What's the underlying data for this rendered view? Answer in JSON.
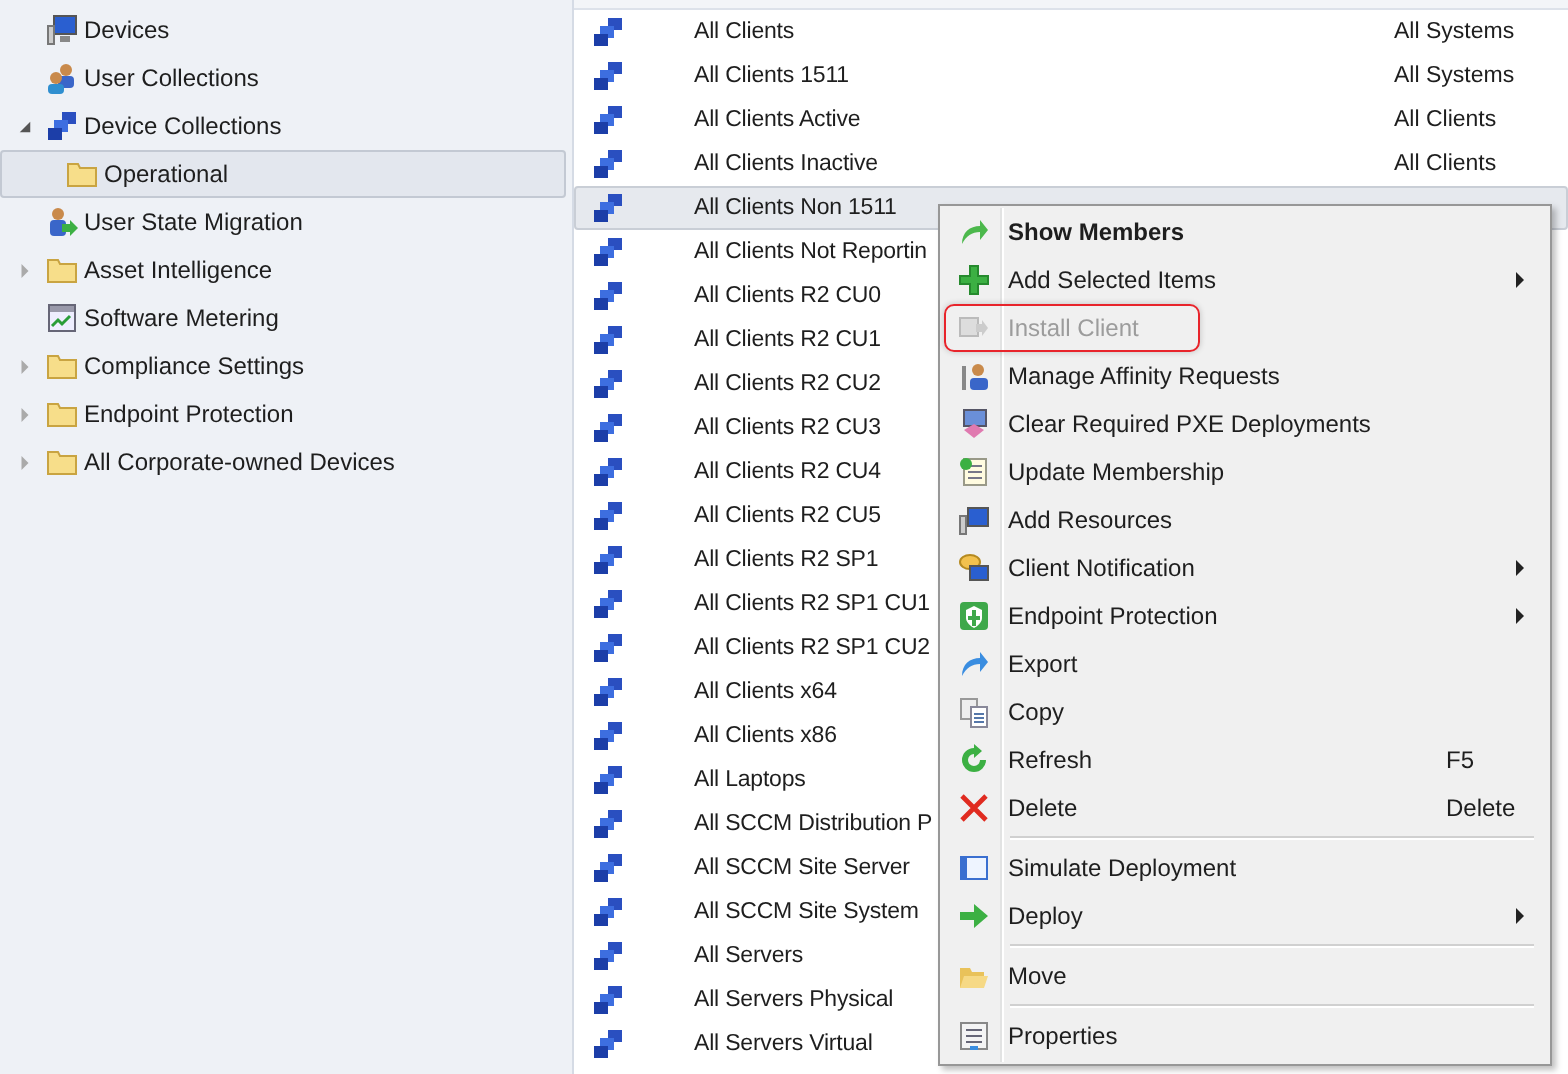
{
  "tree": [
    {
      "label": "Devices",
      "kind": "monitor",
      "selected": false
    },
    {
      "label": "User Collections",
      "kind": "users",
      "selected": false
    },
    {
      "label": "Device Collections",
      "kind": "collection",
      "expanded": true,
      "selected": false,
      "children": [
        {
          "label": "Operational",
          "kind": "folder",
          "selected": true
        }
      ]
    },
    {
      "label": "User State Migration",
      "kind": "migration",
      "selected": false
    },
    {
      "label": "Asset Intelligence",
      "kind": "folder",
      "expanded": false,
      "selected": false
    },
    {
      "label": "Software Metering",
      "kind": "metering",
      "selected": false
    },
    {
      "label": "Compliance Settings",
      "kind": "folder",
      "expanded": false,
      "selected": false
    },
    {
      "label": "Endpoint Protection",
      "kind": "folder",
      "expanded": false,
      "selected": false
    },
    {
      "label": "All Corporate-owned Devices",
      "kind": "folder",
      "expanded": false,
      "selected": false
    }
  ],
  "rows": [
    {
      "name": "All Clients",
      "column_2": "All Systems",
      "selected": false
    },
    {
      "name": "All Clients 1511",
      "column_2": "All Systems",
      "selected": false
    },
    {
      "name": "All Clients Active",
      "column_2": "All Clients",
      "selected": false
    },
    {
      "name": "All Clients Inactive",
      "column_2": "All Clients",
      "selected": false
    },
    {
      "name": "All Clients Non 1511",
      "selected": true
    },
    {
      "name": "All Clients Not Reportin",
      "selected": false
    },
    {
      "name": "All Clients R2 CU0",
      "selected": false
    },
    {
      "name": "All Clients R2 CU1",
      "selected": false
    },
    {
      "name": "All Clients R2 CU2",
      "selected": false
    },
    {
      "name": "All Clients R2 CU3",
      "selected": false
    },
    {
      "name": "All Clients R2 CU4",
      "selected": false
    },
    {
      "name": "All Clients R2 CU5",
      "selected": false
    },
    {
      "name": "All Clients R2 SP1",
      "selected": false
    },
    {
      "name": "All Clients R2 SP1 CU1",
      "selected": false
    },
    {
      "name": "All Clients R2 SP1 CU2",
      "selected": false
    },
    {
      "name": "All Clients x64",
      "selected": false
    },
    {
      "name": "All Clients x86",
      "selected": false
    },
    {
      "name": "All Laptops",
      "selected": false
    },
    {
      "name": "All SCCM Distribution P",
      "selected": false
    },
    {
      "name": "All SCCM Site Server",
      "selected": false
    },
    {
      "name": "All SCCM Site System",
      "selected": false
    },
    {
      "name": "All Servers",
      "selected": false
    },
    {
      "name": "All Servers Physical",
      "selected": false
    },
    {
      "name": "All Servers Virtual",
      "selected": false
    }
  ],
  "context_menu": [
    {
      "label": "Show Members",
      "kind": "arrow-green",
      "default": true,
      "disabled": false,
      "highlighted": false,
      "submenu": false
    },
    {
      "label": "Add Selected Items",
      "kind": "plus",
      "default": false,
      "disabled": false,
      "highlighted": false,
      "submenu": true
    },
    {
      "label": "Install Client",
      "kind": "install",
      "default": false,
      "disabled": true,
      "highlighted": true,
      "submenu": false
    },
    {
      "label": "Manage Affinity Requests",
      "kind": "person",
      "default": false,
      "disabled": false,
      "highlighted": false,
      "submenu": false
    },
    {
      "label": "Clear Required PXE Deployments",
      "kind": "eraser",
      "default": false,
      "disabled": false,
      "highlighted": false,
      "submenu": false
    },
    {
      "label": "Update Membership",
      "kind": "document",
      "default": false,
      "disabled": false,
      "highlighted": false,
      "submenu": false
    },
    {
      "label": "Add Resources",
      "kind": "monitor",
      "default": false,
      "disabled": false,
      "highlighted": false,
      "submenu": false
    },
    {
      "label": "Client Notification",
      "kind": "bubble",
      "default": false,
      "disabled": false,
      "highlighted": false,
      "submenu": true
    },
    {
      "label": "Endpoint Protection",
      "kind": "shield",
      "default": false,
      "disabled": false,
      "highlighted": false,
      "submenu": true
    },
    {
      "label": "Export",
      "kind": "arrow-blue",
      "default": false,
      "disabled": false,
      "highlighted": false,
      "submenu": false
    },
    {
      "label": "Copy",
      "kind": "copy",
      "default": false,
      "disabled": false,
      "highlighted": false,
      "submenu": false
    },
    {
      "label": "Refresh",
      "kind": "refresh",
      "shortcut": "F5",
      "default": false,
      "disabled": false,
      "highlighted": false,
      "submenu": false
    },
    {
      "label": "Delete",
      "kind": "cross",
      "shortcut": "Delete",
      "default": false,
      "disabled": false,
      "highlighted": false,
      "submenu": false
    },
    {
      "kind": "separator"
    },
    {
      "label": "Simulate Deployment",
      "kind": "window",
      "default": false,
      "disabled": false,
      "highlighted": false,
      "submenu": false
    },
    {
      "label": "Deploy",
      "kind": "arrow-right",
      "default": false,
      "disabled": false,
      "highlighted": false,
      "submenu": true
    },
    {
      "kind": "separator"
    },
    {
      "label": "Move",
      "kind": "folder-open",
      "default": false,
      "disabled": false,
      "highlighted": false,
      "submenu": false
    },
    {
      "kind": "separator"
    },
    {
      "label": "Properties",
      "kind": "properties",
      "default": false,
      "disabled": false,
      "highlighted": false,
      "submenu": false
    }
  ]
}
